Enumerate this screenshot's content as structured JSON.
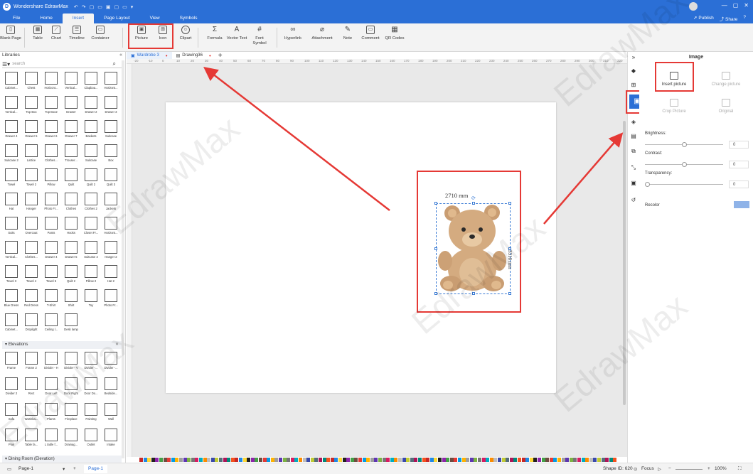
{
  "titlebar": {
    "app_title": "Wondershare EdrawMax",
    "quick_access": [
      "↶",
      "↷",
      "▢",
      "▭",
      "▣",
      "▢",
      "▭",
      "▾"
    ],
    "window_controls": [
      "—",
      "▢",
      "✕"
    ]
  },
  "menubar": {
    "tabs": [
      "File",
      "Home",
      "Insert",
      "Page Layout",
      "View",
      "Symbols"
    ],
    "active_tab": "Insert",
    "publish": "Publish",
    "share": "Share"
  },
  "ribbon": {
    "buttons": [
      {
        "label": "Blank Page",
        "icon": "blank-page-icon",
        "glyph": "▯"
      },
      {
        "label": "Table",
        "icon": "table-icon",
        "glyph": "▦"
      },
      {
        "label": "Chart",
        "icon": "chart-icon",
        "glyph": "⟋"
      },
      {
        "label": "Timeline",
        "icon": "timeline-icon",
        "glyph": "☰"
      },
      {
        "label": "Container",
        "icon": "container-icon",
        "glyph": "▭"
      },
      {
        "label": "Picture",
        "icon": "picture-icon",
        "glyph": "▣"
      },
      {
        "label": "Icon",
        "icon": "icon-icon",
        "glyph": "⊞"
      },
      {
        "label": "Clipart",
        "icon": "clipart-icon",
        "glyph": "☺"
      },
      {
        "label": "Formula",
        "icon": "formula-icon",
        "glyph": "Σ"
      },
      {
        "label": "Vector Text",
        "icon": "vector-text-icon",
        "glyph": "A"
      },
      {
        "label": "Font Symbol",
        "icon": "font-symbol-icon",
        "glyph": "#"
      },
      {
        "label": "Hyperlink",
        "icon": "hyperlink-icon",
        "glyph": "∞"
      },
      {
        "label": "Attachment",
        "icon": "attachment-icon",
        "glyph": "⌀"
      },
      {
        "label": "Note",
        "icon": "note-icon",
        "glyph": "✎"
      },
      {
        "label": "Comment",
        "icon": "comment-icon",
        "glyph": "▭"
      },
      {
        "label": "QR Codes",
        "icon": "qr-code-icon",
        "glyph": "▦"
      }
    ]
  },
  "library": {
    "title": "Libraries",
    "search_placeholder": "search",
    "shapes": [
      "Cabinet...",
      "Chest",
      "Horizont...",
      "Vertical...",
      "Clapboa...",
      "Horizont...",
      "Vertical...",
      "Top Box",
      "Top Box2",
      "Drawer",
      "Drawer 2",
      "Drawer 3",
      "Drawer 4",
      "Drawer 5",
      "Drawer 6",
      "Drawer 7",
      "Baskets",
      "Suitcase",
      "Suitcase 2",
      "Lattice",
      "Clothes...",
      "Trouser...",
      "Suitcase",
      "Box",
      "Towel",
      "Towel 2",
      "Pillow",
      "Quilt",
      "Quilt 2",
      "Quilt 3",
      "Hat",
      "Hanger",
      "Photo Fr...",
      "Clothes",
      "Clothes 2",
      "Jackets",
      "Suits",
      "Overcoat",
      "Pants",
      "Hooks",
      "Closet Fr...",
      "Horizont...",
      "Vertical...",
      "Clothes...",
      "Drawer 4",
      "Drawer 5",
      "Suitcase 2",
      "Hanger 2",
      "Towel 3",
      "Towel 4",
      "Towel 5",
      "Quilt 2",
      "Pillow 2",
      "Hat 2",
      "Blue Dress",
      "Red Dress",
      "T-Shirt",
      "Shirt",
      "Toy",
      "Photo Fr...",
      "Cabinet...",
      "Droplight",
      "Ceiling l...",
      "Desk lamp"
    ],
    "section_elevations": "Elevations",
    "elevation_shapes": [
      "Frame",
      "Frame 2",
      "Divider - H",
      "Divider - V",
      "Divider -...",
      "Divider -...",
      "Divider 2",
      "Rect",
      "Door Left",
      "Door Right",
      "Door Do...",
      "Bedside...",
      "Sofa",
      "Washba...",
      "Plants",
      "Fireplace",
      "Painting",
      "Wall",
      "Plus",
      "Table fa...",
      "L table f...",
      "Drainag...",
      "Outlet",
      "Intake"
    ],
    "section_dining": "Dining Room (Elevation)"
  },
  "doc_tabs": [
    {
      "label": "Wardrobe 3",
      "active": true
    },
    {
      "label": "Drawing36",
      "active": false
    }
  ],
  "ruler_ticks": [
    "-20",
    "-10",
    "0",
    "10",
    "20",
    "30",
    "40",
    "50",
    "60",
    "70",
    "80",
    "90",
    "100",
    "110",
    "120",
    "130",
    "140",
    "150",
    "160",
    "170",
    "180",
    "190",
    "200",
    "210",
    "220",
    "230",
    "240",
    "250",
    "260",
    "270",
    "280",
    "290",
    "300",
    "310",
    "320"
  ],
  "canvas": {
    "width_dim": "2710 mm",
    "height_dim": "3310 mm",
    "shape_icon": "teddy-bear-image"
  },
  "right_panel": {
    "title": "Image",
    "insert_picture": "Insert picture",
    "change_picture": "Change picture",
    "crop_picture": "Crop Picture",
    "original": "Original",
    "brightness": "Brightness:",
    "contrast": "Contrast:",
    "transparency": "Transparency:",
    "recolor": "Recolor",
    "brightness_value": "0",
    "contrast_value": "0",
    "transparency_value": "0"
  },
  "statusbar": {
    "page_label": "Page-1",
    "page_tab": "Page-1",
    "add": "+",
    "shape_id": "Shape ID: 620",
    "focus": "Focus",
    "zoom": "100%"
  },
  "watermark": "EdrawMax",
  "colors": {
    "accent": "#2b6fd6",
    "highlight": "#e53935"
  }
}
